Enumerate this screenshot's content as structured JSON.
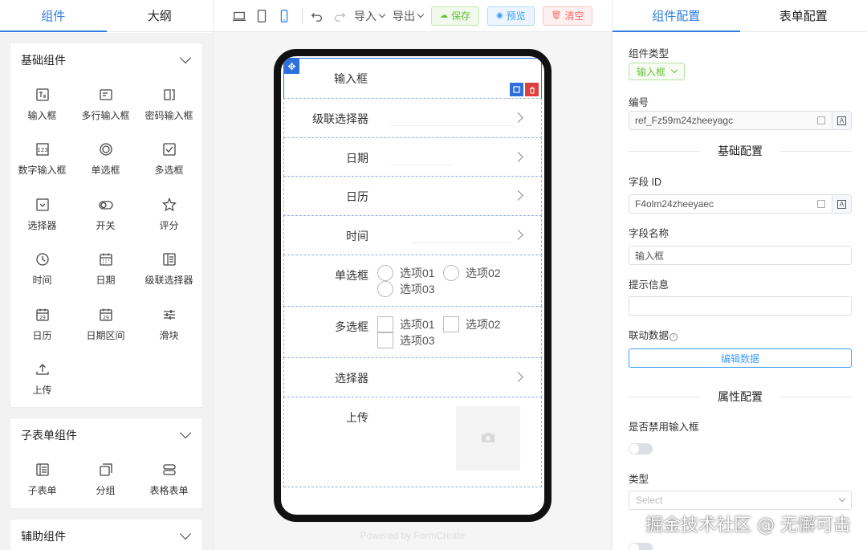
{
  "left_tabs": [
    "组件",
    "大纲"
  ],
  "groups": {
    "basic": {
      "title": "基础组件",
      "items": [
        {
          "label": "输入框",
          "icon": "input-icon"
        },
        {
          "label": "多行输入框",
          "icon": "textarea-icon"
        },
        {
          "label": "密码输入框",
          "icon": "password-icon"
        },
        {
          "label": "数字输入框",
          "icon": "number-input-icon"
        },
        {
          "label": "单选框",
          "icon": "radio-icon"
        },
        {
          "label": "多选框",
          "icon": "checkbox-icon"
        },
        {
          "label": "选择器",
          "icon": "select-icon"
        },
        {
          "label": "开关",
          "icon": "switch-icon"
        },
        {
          "label": "评分",
          "icon": "star-icon"
        },
        {
          "label": "时间",
          "icon": "clock-icon"
        },
        {
          "label": "日期",
          "icon": "date-icon"
        },
        {
          "label": "级联选择器",
          "icon": "cascader-icon"
        },
        {
          "label": "日历",
          "icon": "calendar-icon"
        },
        {
          "label": "日期区间",
          "icon": "date-range-icon"
        },
        {
          "label": "滑块",
          "icon": "slider-icon"
        },
        {
          "label": "上传",
          "icon": "upload-icon"
        }
      ]
    },
    "subform": {
      "title": "子表单组件",
      "items": [
        {
          "label": "子表单",
          "icon": "subform-icon"
        },
        {
          "label": "分组",
          "icon": "group-icon"
        },
        {
          "label": "表格表单",
          "icon": "table-form-icon"
        }
      ]
    },
    "aux": {
      "title": "辅助组件"
    }
  },
  "toolbar": {
    "import": "导入",
    "export": "导出",
    "save": "保存",
    "preview": "预览",
    "clear": "清空"
  },
  "form": {
    "input_label": "输入框",
    "cascader_label": "级联选择器",
    "date_label": "日期",
    "calendar_label": "日历",
    "time_label": "时间",
    "radio_label": "单选框",
    "checkbox_label": "多选框",
    "select_label": "选择器",
    "upload_label": "上传",
    "options": [
      "选项01",
      "选项02",
      "选项03"
    ],
    "powered": "Powered by FormCreate"
  },
  "right_tabs": [
    "组件配置",
    "表单配置"
  ],
  "config": {
    "type_label": "组件类型",
    "type_value": "输入框",
    "ref_label": "编号",
    "ref_value": "ref_Fz59m24zheeyagc",
    "basic_section": "基础配置",
    "field_id_label": "字段 ID",
    "field_id_value": "F4olm24zheeyaec",
    "field_name_label": "字段名称",
    "field_name_value": "输入框",
    "hint_label": "提示信息",
    "hint_value": "",
    "linked_label": "联动数据",
    "edit_data": "编辑数据",
    "attr_section": "属性配置",
    "disabled_label": "是否禁用输入框",
    "kind_label": "类型",
    "kind_placeholder": "Select"
  },
  "watermark": "掘金技术社区 @ 无懈可击",
  "colors": {
    "accent": "#2f7de1",
    "save": "#67c23a",
    "preview": "#409eff",
    "clear": "#f56c6c"
  }
}
